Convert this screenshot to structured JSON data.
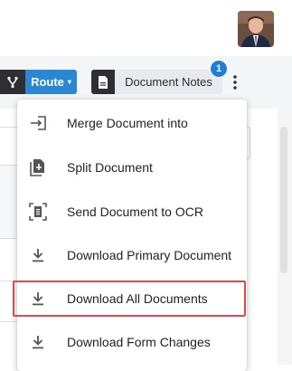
{
  "header": {
    "avatar_icon": "user-avatar-photo"
  },
  "toolbar": {
    "workflow_icon": "workflow-branch-icon",
    "route_label": "Route",
    "route_caret": "▾",
    "document_icon": "document-icon",
    "notes_label": "Document Notes",
    "notes_badge": "1",
    "more_icon": "kebab-vertical-icon"
  },
  "menu": {
    "items": [
      {
        "label": "Merge Document into",
        "icon": "merge-arrow-icon"
      },
      {
        "label": "Split Document",
        "icon": "split-document-icon"
      },
      {
        "label": "Send Document to OCR",
        "icon": "ocr-scan-icon"
      },
      {
        "label": "Download Primary Document",
        "icon": "download-icon"
      },
      {
        "label": "Download All Documents",
        "icon": "download-icon",
        "highlighted": true
      },
      {
        "label": "Download Form Changes",
        "icon": "download-icon"
      }
    ]
  },
  "colors": {
    "route_button": "#2b86d3",
    "badge": "#1e7fd4",
    "highlight_border": "#e54646",
    "dark_button": "#2f2f33"
  }
}
